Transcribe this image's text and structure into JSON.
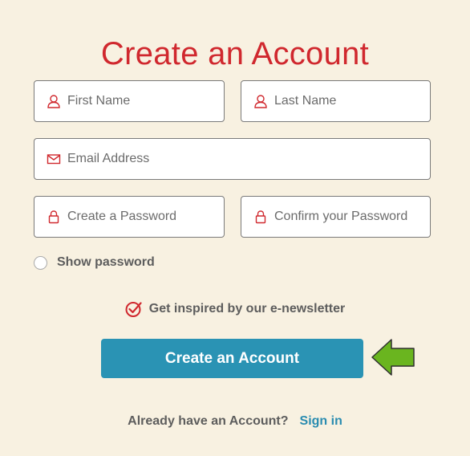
{
  "page": {
    "title": "Create an Account"
  },
  "form": {
    "first_name": {
      "placeholder": "First Name",
      "value": ""
    },
    "last_name": {
      "placeholder": "Last Name",
      "value": ""
    },
    "email": {
      "placeholder": "Email Address",
      "value": ""
    },
    "password": {
      "placeholder": "Create a Password",
      "value": ""
    },
    "confirm_password": {
      "placeholder": "Confirm your Password",
      "value": ""
    },
    "show_password": {
      "label": "Show password",
      "checked": false
    },
    "newsletter": {
      "label": "Get inspired by our e-newsletter",
      "checked": true
    },
    "submit_label": "Create an Account"
  },
  "footer": {
    "prompt": "Already have an Account?",
    "signin_label": "Sign in"
  },
  "colors": {
    "accent_red": "#d0282e",
    "button_blue": "#2a93b4",
    "link_blue": "#2a8cb0",
    "arrow_green": "#6ab51f",
    "background": "#f8f1e1"
  },
  "icons": {
    "name_field": "user-icon",
    "email_field": "mail-icon",
    "password_field": "lock-icon",
    "newsletter": "check-circle-icon",
    "annotation": "arrow-left-icon"
  }
}
